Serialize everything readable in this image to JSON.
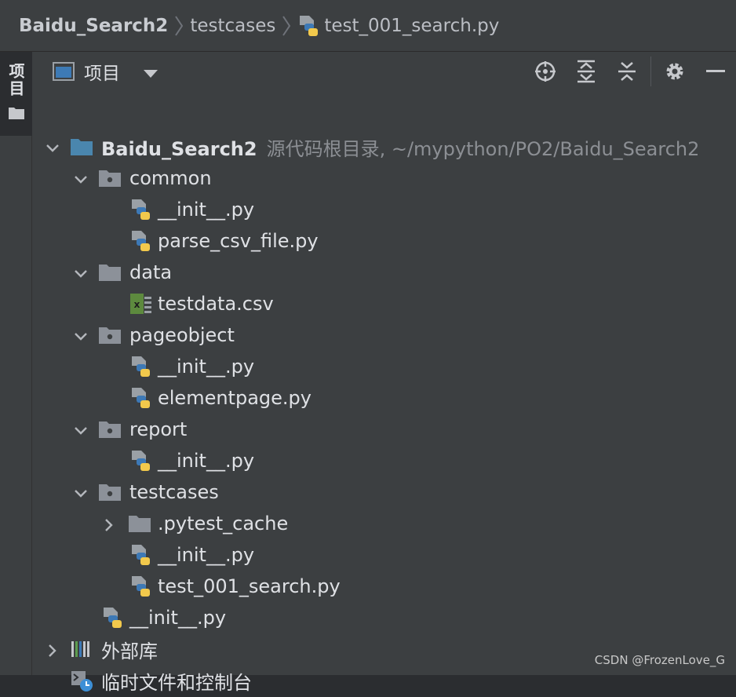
{
  "breadcrumb": {
    "project": "Baidu_Search2",
    "folder": "testcases",
    "file": "test_001_search.py"
  },
  "strip": {
    "tab_label": "项目"
  },
  "toolbar": {
    "title": "项目"
  },
  "tree": {
    "root": {
      "name": "Baidu_Search2",
      "hint": "源代码根目录, ~/mypython/PO2/Baidu_Search2"
    },
    "rows": [
      {
        "label": "common"
      },
      {
        "label": "__init__.py"
      },
      {
        "label": "parse_csv_file.py"
      },
      {
        "label": "data"
      },
      {
        "label": "testdata.csv"
      },
      {
        "label": "pageobject"
      },
      {
        "label": "__init__.py"
      },
      {
        "label": "elementpage.py"
      },
      {
        "label": "report"
      },
      {
        "label": "__init__.py"
      },
      {
        "label": "testcases"
      },
      {
        "label": ".pytest_cache"
      },
      {
        "label": "__init__.py"
      },
      {
        "label": "test_001_search.py"
      },
      {
        "label": "__init__.py"
      },
      {
        "label": "外部库"
      },
      {
        "label": "临时文件和控制台"
      }
    ]
  },
  "watermark": "CSDN @FrozenLove_G",
  "colors": {
    "background": "#3c3f41",
    "folder": "#8c9199",
    "module": "#4a86ae",
    "python_blue": "#3d79b6",
    "python_yellow": "#f2c94c",
    "csv_green": "#5d8a3e"
  }
}
